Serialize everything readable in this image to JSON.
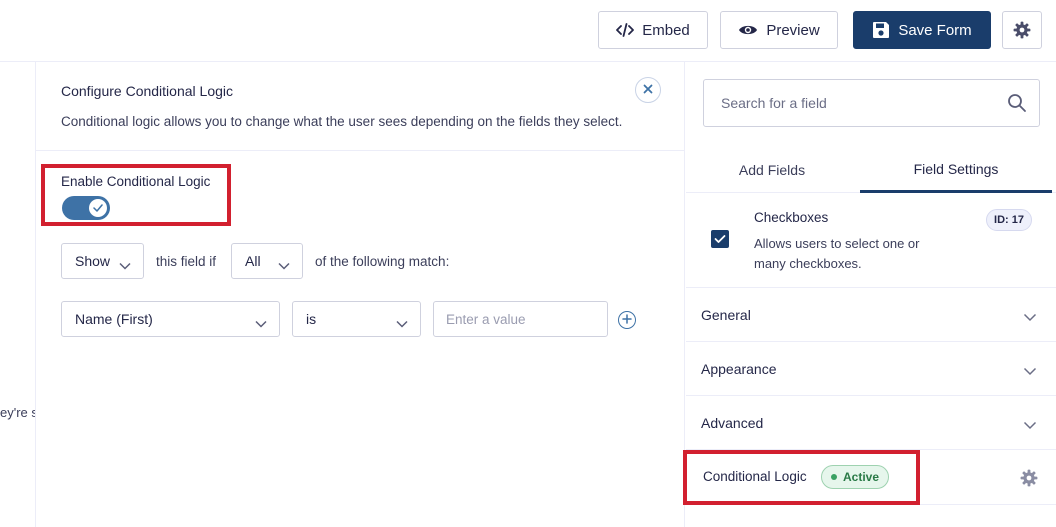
{
  "toolbar": {
    "embed_label": "Embed",
    "preview_label": "Preview",
    "save_label": "Save Form",
    "primary_color": "#1a3d6b"
  },
  "canvas": {
    "partial_text": "ey're s"
  },
  "conditional_logic_panel": {
    "title": "Configure Conditional Logic",
    "description": "Conditional logic allows you to change what the user sees depending on the fields they select.",
    "enable_label": "Enable Conditional Logic",
    "enabled": true,
    "action_select": "Show",
    "this_field_if_text": "this field if",
    "match_select": "All",
    "following_match_text": "of the following match:",
    "rule": {
      "field": "Name (First)",
      "operator": "is",
      "value_placeholder": "Enter a value"
    },
    "highlight_color": "#d2202f"
  },
  "sidebar": {
    "search_placeholder": "Search for a field",
    "tabs": [
      {
        "label": "Add Fields",
        "active": false
      },
      {
        "label": "Field Settings",
        "active": true
      }
    ],
    "field": {
      "name": "Checkboxes",
      "description": "Allows users to select one or many checkboxes.",
      "id_badge": "ID: 17"
    },
    "sections": [
      {
        "label": "General"
      },
      {
        "label": "Appearance"
      },
      {
        "label": "Advanced"
      }
    ],
    "conditional_logic": {
      "label": "Conditional Logic",
      "status": "Active",
      "status_color": "#3aa163"
    }
  }
}
